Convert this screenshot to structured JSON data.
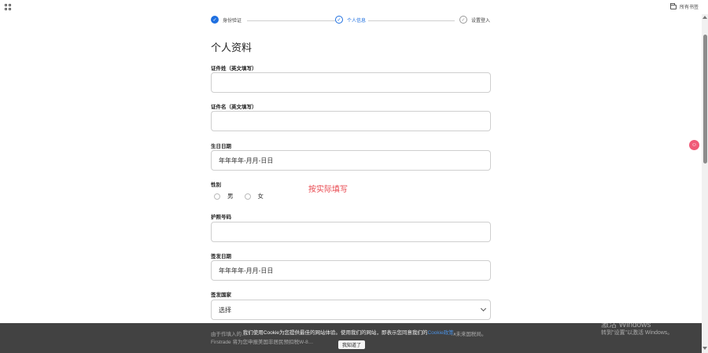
{
  "browser": {
    "bookmarks_label": "所有书签"
  },
  "steps": [
    {
      "label": "身份验证",
      "state": "done"
    },
    {
      "label": "个人信息",
      "state": "current"
    },
    {
      "label": "设置登入",
      "state": "todo"
    }
  ],
  "page": {
    "title": "个人资料"
  },
  "form": {
    "surname_label": "证件姓（英文填写）",
    "surname_value": "",
    "given_name_label": "证件名（英文填写）",
    "given_name_value": "",
    "birthdate_label": "生日日期",
    "birthdate_value": "年年年年-月月-日日",
    "gender_label": "性别",
    "gender_options": [
      "男",
      "女"
    ],
    "passport_label": "护照号码",
    "passport_value": "",
    "issue_date_label": "签发日期",
    "issue_date_value": "年年年年-月月-日日",
    "issue_country_label": "签发国家",
    "issue_country_value": "选择"
  },
  "annotation": {
    "note": "按实际填写"
  },
  "behind_text": {
    "line1": "由于作填入的…",
    "line2": "Firstrade 将为您申报美国非居民预扣税W-8…",
    "line1_end": "…未来国税局。"
  },
  "cookie": {
    "text_before": "我们使用Cookie为您提供最佳的网站体验。使用我们的网站，即表示您同意我们的",
    "link_text": "Cookie政策",
    "text_after": "。",
    "button_label": "我知道了"
  },
  "watermark": {
    "line1": "激活 Windows",
    "line2": "转到\"设置\"以激活 Windows。"
  },
  "colors": {
    "accent": "#1e6fe0",
    "note": "#e8454c",
    "float_button": "#f05a78"
  },
  "icons": {
    "apps": "apps-grid-icon",
    "bookmarks": "folder-icon",
    "float": "chat-icon"
  }
}
